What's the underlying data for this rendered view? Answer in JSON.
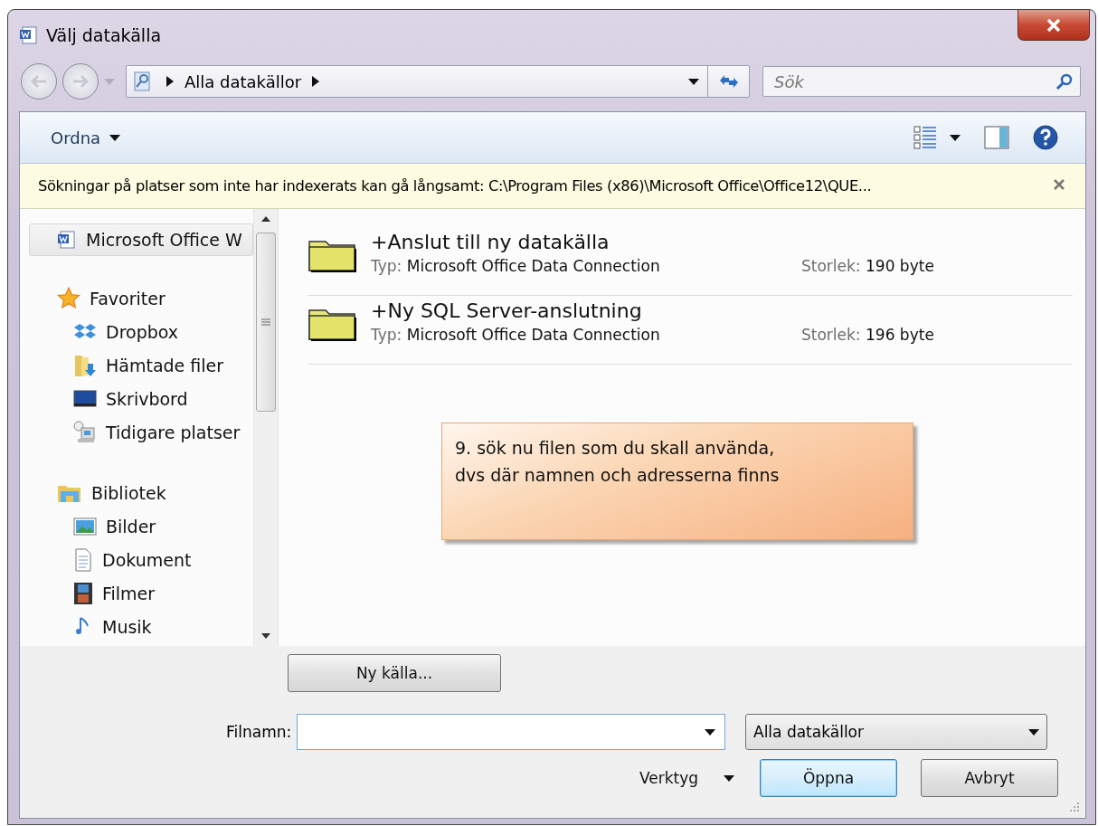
{
  "window": {
    "title": "Välj datakälla"
  },
  "address_bar": {
    "crumbs": [
      "Alla datakällor"
    ]
  },
  "search": {
    "placeholder": "Sök"
  },
  "toolbar": {
    "organize": "Ordna"
  },
  "info_bar": {
    "message": "Sökningar på platser som inte har indexerats kan gå långsamt: C:\\Program Files (x86)\\Microsoft Office\\Office12\\QUE..."
  },
  "sidebar": {
    "items": [
      {
        "label": "Microsoft Office W",
        "kind": "root",
        "selected": true
      },
      {
        "label": "Favoriter",
        "kind": "group",
        "selected": false
      },
      {
        "label": "Dropbox",
        "kind": "item",
        "selected": false
      },
      {
        "label": "Hämtade filer",
        "kind": "item",
        "selected": false
      },
      {
        "label": "Skrivbord",
        "kind": "item",
        "selected": false
      },
      {
        "label": "Tidigare platser",
        "kind": "item",
        "selected": false
      },
      {
        "label": "Bibliotek",
        "kind": "group",
        "selected": false
      },
      {
        "label": "Bilder",
        "kind": "item",
        "selected": false
      },
      {
        "label": "Dokument",
        "kind": "item",
        "selected": false
      },
      {
        "label": "Filmer",
        "kind": "item",
        "selected": false
      },
      {
        "label": "Musik",
        "kind": "item",
        "selected": false
      }
    ]
  },
  "files": [
    {
      "name": "+Anslut till ny datakälla",
      "type_label": "Typ:",
      "type": "Microsoft Office Data Connection",
      "size_label": "Storlek:",
      "size": "190 byte"
    },
    {
      "name": "+Ny SQL Server-anslutning",
      "type_label": "Typ:",
      "type": "Microsoft Office Data Connection",
      "size_label": "Storlek:",
      "size": "196 byte"
    }
  ],
  "note": {
    "lines": [
      "9. sök nu filen som du skall använda,",
      "dvs där namnen och adresserna finns"
    ]
  },
  "bottom": {
    "new_source": "Ny källa...",
    "filename_label": "Filnamn:",
    "file_type": "Alla datakällor",
    "tools": "Verktyg",
    "open": "Öppna",
    "cancel": "Avbryt"
  }
}
